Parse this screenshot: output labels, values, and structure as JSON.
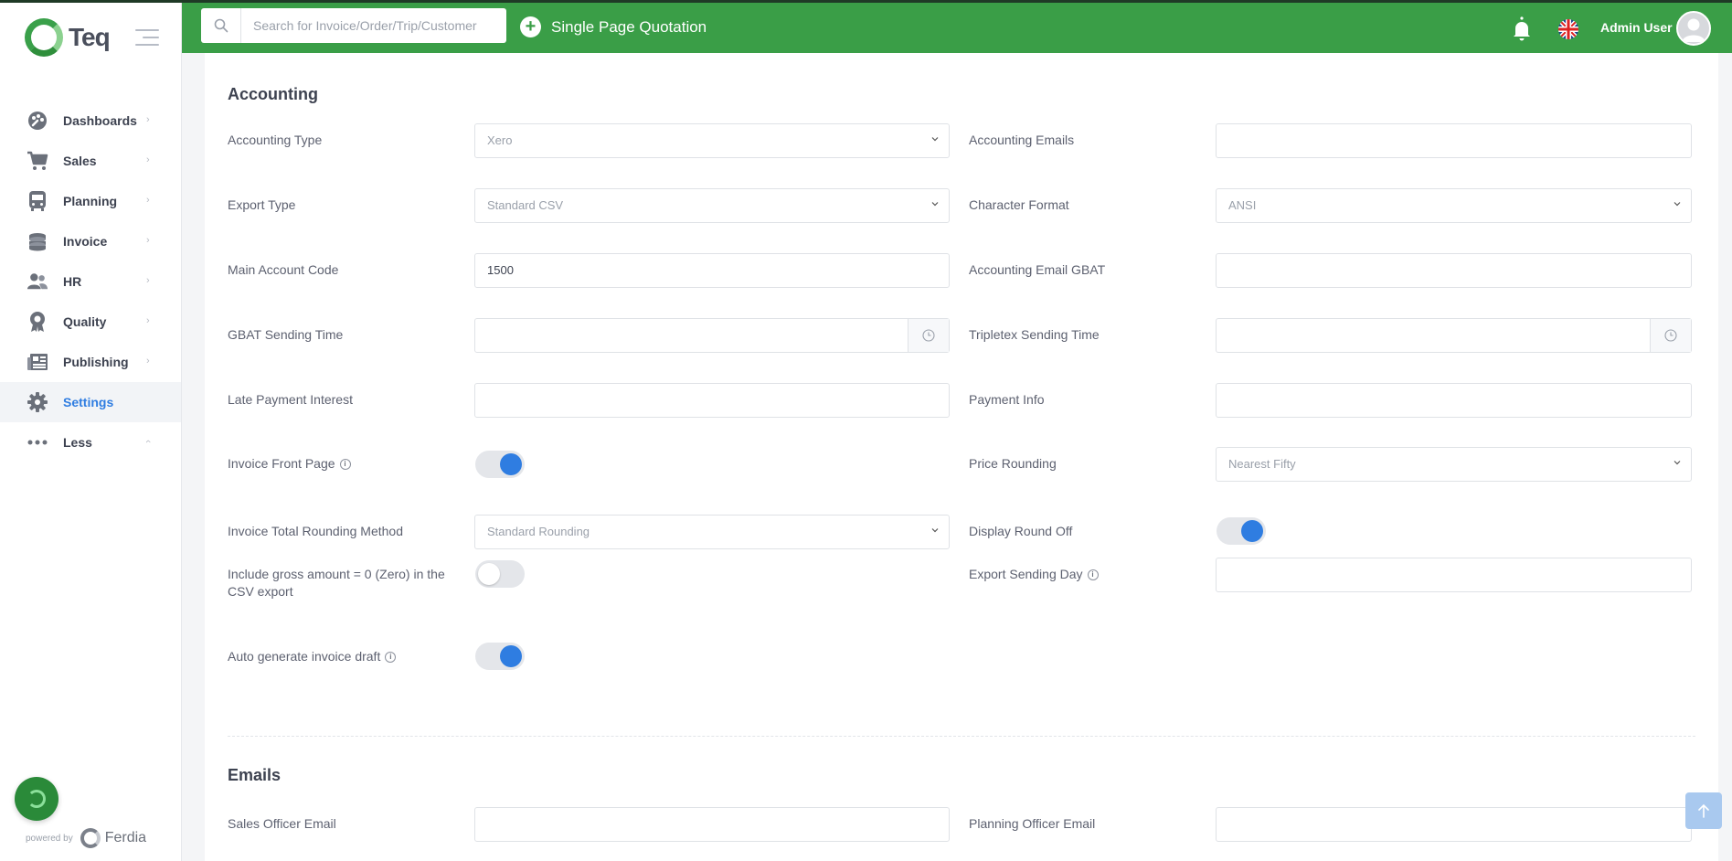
{
  "app": {
    "logo_text": "Teq"
  },
  "sidebar": {
    "items": [
      {
        "label": "Dashboards",
        "icon": "palette-icon",
        "chevron": "›"
      },
      {
        "label": "Sales",
        "icon": "cart-icon",
        "chevron": "›"
      },
      {
        "label": "Planning",
        "icon": "bus-icon",
        "chevron": "›"
      },
      {
        "label": "Invoice",
        "icon": "coins-icon",
        "chevron": "›"
      },
      {
        "label": "HR",
        "icon": "users-icon",
        "chevron": "›"
      },
      {
        "label": "Quality",
        "icon": "award-icon",
        "chevron": "›"
      },
      {
        "label": "Publishing",
        "icon": "newspaper-icon",
        "chevron": "›"
      },
      {
        "label": "Settings",
        "icon": "gear-icon",
        "active": true
      },
      {
        "label": "Less",
        "icon": "dots-icon",
        "chevron": "‹"
      }
    ],
    "powered_by": "powered by",
    "brand": "Ferdia"
  },
  "topbar": {
    "search_placeholder": "Search for Invoice/Order/Trip/Customer",
    "quotation_label": "Single Page Quotation",
    "user_name": "Admin User",
    "color": "#3a9e47"
  },
  "accounting": {
    "title": "Accounting",
    "accounting_type": {
      "label": "Accounting Type",
      "value": "Xero"
    },
    "accounting_emails": {
      "label": "Accounting Emails",
      "value": ""
    },
    "export_type": {
      "label": "Export Type",
      "value": "Standard CSV"
    },
    "character_format": {
      "label": "Character Format",
      "value": "ANSI"
    },
    "main_account_code": {
      "label": "Main Account Code",
      "value": "1500"
    },
    "accounting_email_gbat": {
      "label": "Accounting Email GBAT",
      "value": ""
    },
    "gbat_sending_time": {
      "label": "GBAT Sending Time",
      "value": ""
    },
    "tripletex_sending_time": {
      "label": "Tripletex Sending Time",
      "value": ""
    },
    "late_payment_interest": {
      "label": "Late Payment Interest",
      "value": ""
    },
    "payment_info": {
      "label": "Payment Info",
      "value": ""
    },
    "invoice_front_page": {
      "label": "Invoice Front Page",
      "on": true
    },
    "price_rounding": {
      "label": "Price Rounding",
      "value": "Nearest Fifty"
    },
    "invoice_total_rounding": {
      "label": "Invoice Total Rounding Method",
      "value": "Standard Rounding"
    },
    "display_round_off": {
      "label": "Display Round Off",
      "on": true
    },
    "include_gross_zero": {
      "label": "Include gross amount = 0 (Zero) in the CSV export",
      "on": false
    },
    "export_sending_day": {
      "label": "Export Sending Day",
      "value": ""
    },
    "auto_generate_draft": {
      "label": "Auto generate invoice draft",
      "on": true
    }
  },
  "emails": {
    "title": "Emails",
    "sales_officer_email": {
      "label": "Sales Officer Email",
      "value": ""
    },
    "planning_officer_email": {
      "label": "Planning Officer Email",
      "value": ""
    }
  },
  "colors": {
    "accent": "#2f7de1",
    "brand_green": "#3a9e47"
  }
}
